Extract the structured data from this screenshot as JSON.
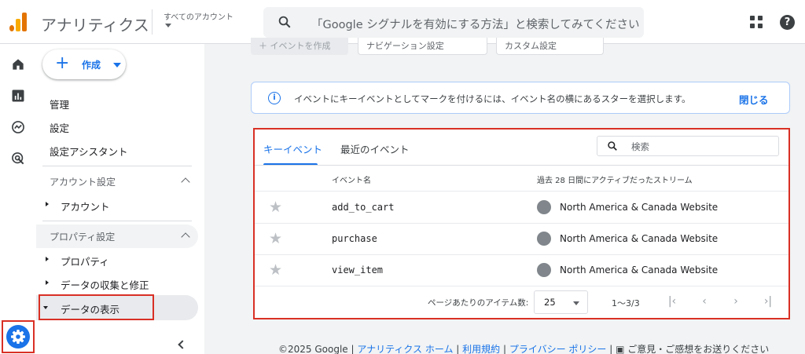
{
  "header": {
    "app_title": "アナリティクス",
    "account_label": "すべてのアカウント",
    "search_placeholder": "「Google シグナルを有効にする方法」と検索してみてください",
    "help_glyph": "?"
  },
  "nav": {
    "create_label": "作成",
    "items": [
      "管理",
      "設定",
      "設定アシスタント"
    ],
    "account_section": "アカウント設定",
    "account_item": "アカウント",
    "property_section": "プロパティ設定",
    "property_items": [
      "プロパティ",
      "データの収集と修正",
      "データの表示"
    ]
  },
  "main": {
    "top_buttons": [
      "＋ イベントを作成",
      "ナビゲーション設定",
      "カスタム設定"
    ],
    "banner_text": "イベントにキーイベントとしてマークを付けるには、イベント名の横にあるスターを選択します。",
    "banner_close": "閉じる",
    "tabs": [
      "キーイベント",
      "最近のイベント"
    ],
    "search_placeholder": "検索",
    "columns": [
      "イベント名",
      "過去 28 日間にアクティブだったストリーム"
    ],
    "rows": [
      {
        "event": "add_to_cart",
        "stream": "North America & Canada Website"
      },
      {
        "event": "purchase",
        "stream": "North America & Canada Website"
      },
      {
        "event": "view_item",
        "stream": "North America & Canada Website"
      }
    ],
    "pagination": {
      "label": "ページあたりのアイテム数:",
      "page_size": "25",
      "range": "1〜3/3"
    }
  },
  "footer": {
    "copyright": "©2025 Google",
    "links": [
      "アナリティクス ホーム",
      "利用規約",
      "プライバシー ポリシー"
    ],
    "feedback": "ご意見・ご感想をお送りください"
  },
  "colors": {
    "accent": "#1a73e8",
    "highlight": "#d93025"
  }
}
